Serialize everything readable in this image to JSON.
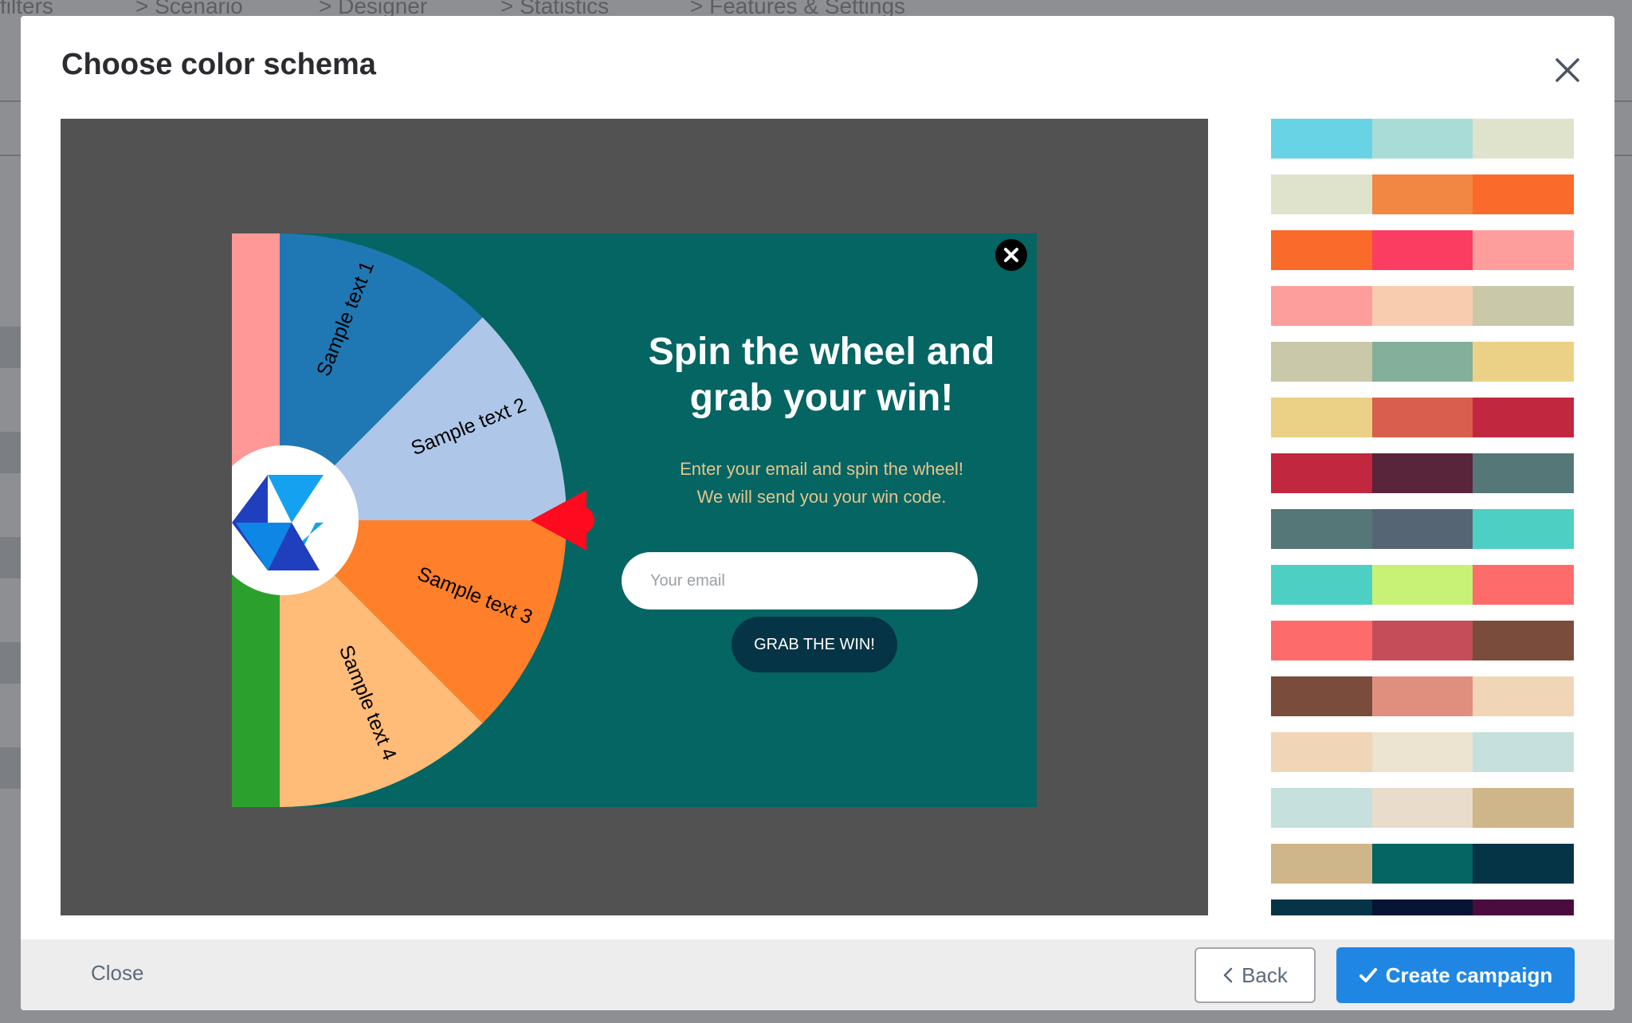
{
  "background_nav": {
    "items": [
      "filters",
      "> Scenario",
      "> Designer",
      "> Statistics",
      "> Features & Settings"
    ]
  },
  "modal": {
    "title": "Choose color schema",
    "close_icon": "close-icon"
  },
  "popup": {
    "headline_line1": "Spin the wheel and",
    "headline_line2": "grab your win!",
    "subtext_line1": "Enter your email and spin the wheel!",
    "subtext_line2": "We will send you your win code.",
    "email_placeholder": "Your email",
    "button_label": "GRAB THE WIN!",
    "colors": {
      "background": "#046563",
      "headline": "#ffffff",
      "subtext": "#e7c48d",
      "button": "#053446",
      "pointer": "#ff0a1f"
    },
    "wheel": {
      "segments": [
        {
          "label": "Sample text 1",
          "color": "#1f78b4"
        },
        {
          "label": "Sample text 2",
          "color": "#aec7e8"
        },
        {
          "label": "Sample text 3",
          "color": "#ff7f2a"
        },
        {
          "label": "Sample text 4",
          "color": "#ffbb78"
        }
      ],
      "edge_colors": {
        "top": "#ff9896",
        "bottom": "#2ca02c"
      },
      "logo": "blue-triangle-logo"
    }
  },
  "palettes": [
    [
      "#69d3e6",
      "#a9dcd7",
      "#e0e3cc"
    ],
    [
      "#e0e3cc",
      "#f28743",
      "#fa6a2a"
    ],
    [
      "#fa6a2a",
      "#fc3d62",
      "#fe9e9c"
    ],
    [
      "#fe9e9c",
      "#f8cdaf",
      "#c9c8a8"
    ],
    [
      "#c9c8a8",
      "#84af9b",
      "#ebd186"
    ],
    [
      "#ebd186",
      "#da5e4d",
      "#c1273f"
    ],
    [
      "#c1273f",
      "#59253a",
      "#557777"
    ],
    [
      "#557777",
      "#566574",
      "#4ecfc4"
    ],
    [
      "#4ecfc4",
      "#c7f275",
      "#fe6b6b"
    ],
    [
      "#fe6b6b",
      "#c44d59",
      "#7a4c3b"
    ],
    [
      "#7a4c3b",
      "#e08f7e",
      "#f0d5b6"
    ],
    [
      "#f0d5b6",
      "#ece3d0",
      "#c5e0dd"
    ],
    [
      "#c5e0dd",
      "#e9dccb",
      "#cfb68a"
    ],
    [
      "#cfb68a",
      "#046563",
      "#053446"
    ],
    [
      "#053446",
      "#061436",
      "#4a0c3c"
    ]
  ],
  "footer": {
    "close_label": "Close",
    "back_label": "Back",
    "create_label": "Create campaign"
  }
}
